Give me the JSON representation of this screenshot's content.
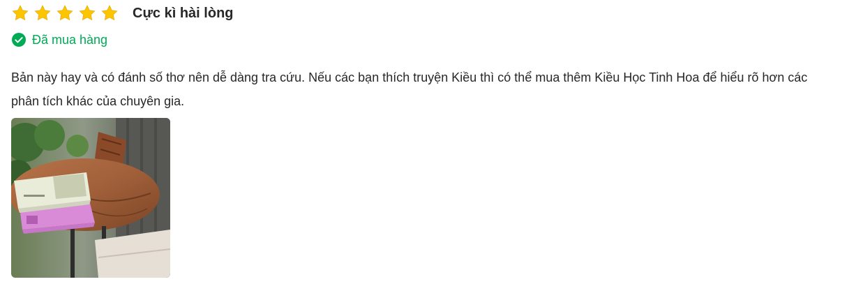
{
  "review": {
    "rating": 5,
    "max_rating": 5,
    "rating_title": "Cực kì hài lòng",
    "purchased_label": "Đã mua hàng",
    "content": "Bản này hay và có đánh số thơ nên dễ dàng tra cứu. Nếu các bạn thích truyện Kiều thì có thể mua thêm Kiều Học Tinh Hoa để hiểu rõ hơn các phân tích khác của chuyên gia.",
    "photo_icon": "review-photo-books-on-table"
  },
  "colors": {
    "star": "#ffc400",
    "verified": "#00ab56",
    "text": "#27272a"
  },
  "icons": {
    "star": "star-icon",
    "verified": "check-circle-icon"
  }
}
